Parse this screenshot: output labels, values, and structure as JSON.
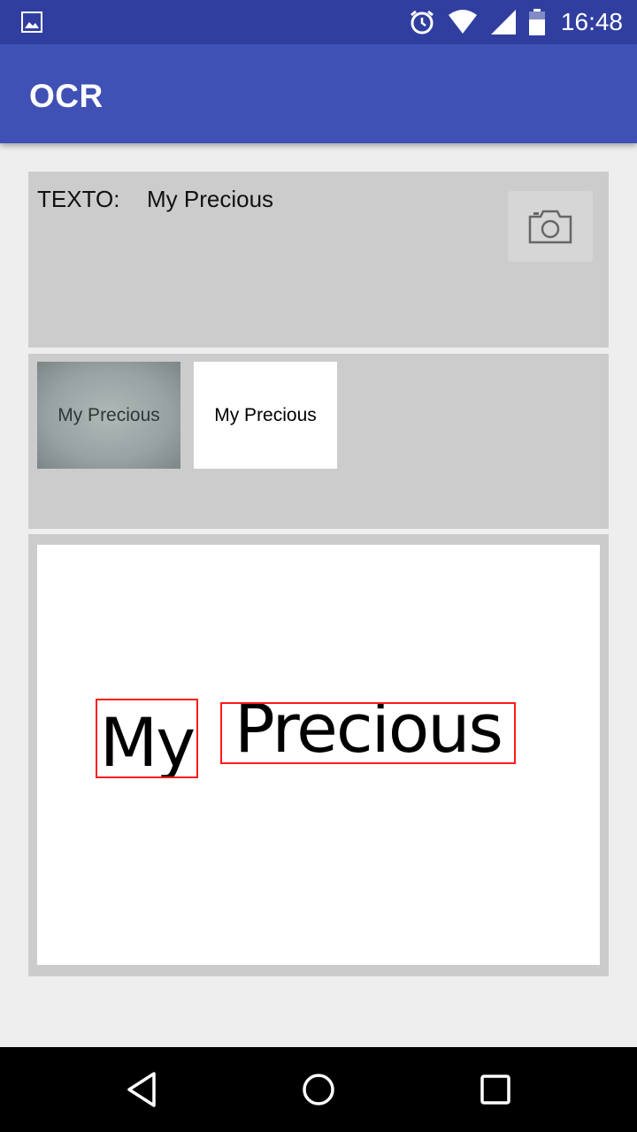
{
  "status_bar": {
    "time": "16:48",
    "icons": [
      "image-notification-icon",
      "alarm-icon",
      "wifi-icon",
      "signal-icon",
      "battery-icon"
    ]
  },
  "app_bar": {
    "title": "OCR"
  },
  "result_panel": {
    "label": "TEXTO:",
    "value": "My Precious",
    "camera_button_icon": "camera-icon"
  },
  "thumbnails": [
    {
      "text": "My Precious",
      "kind": "original-photo"
    },
    {
      "text": "My Precious",
      "kind": "binarized"
    }
  ],
  "preview": {
    "words": [
      "My",
      "Precious"
    ],
    "box_color": "#ff1a1a"
  },
  "nav_bar": {
    "icons": [
      "back-icon",
      "home-icon",
      "recents-icon"
    ]
  },
  "colors": {
    "status_bar": "#303f9f",
    "app_bar": "#3f51b5",
    "panel": "#cccccc",
    "background": "#eeeeee"
  }
}
